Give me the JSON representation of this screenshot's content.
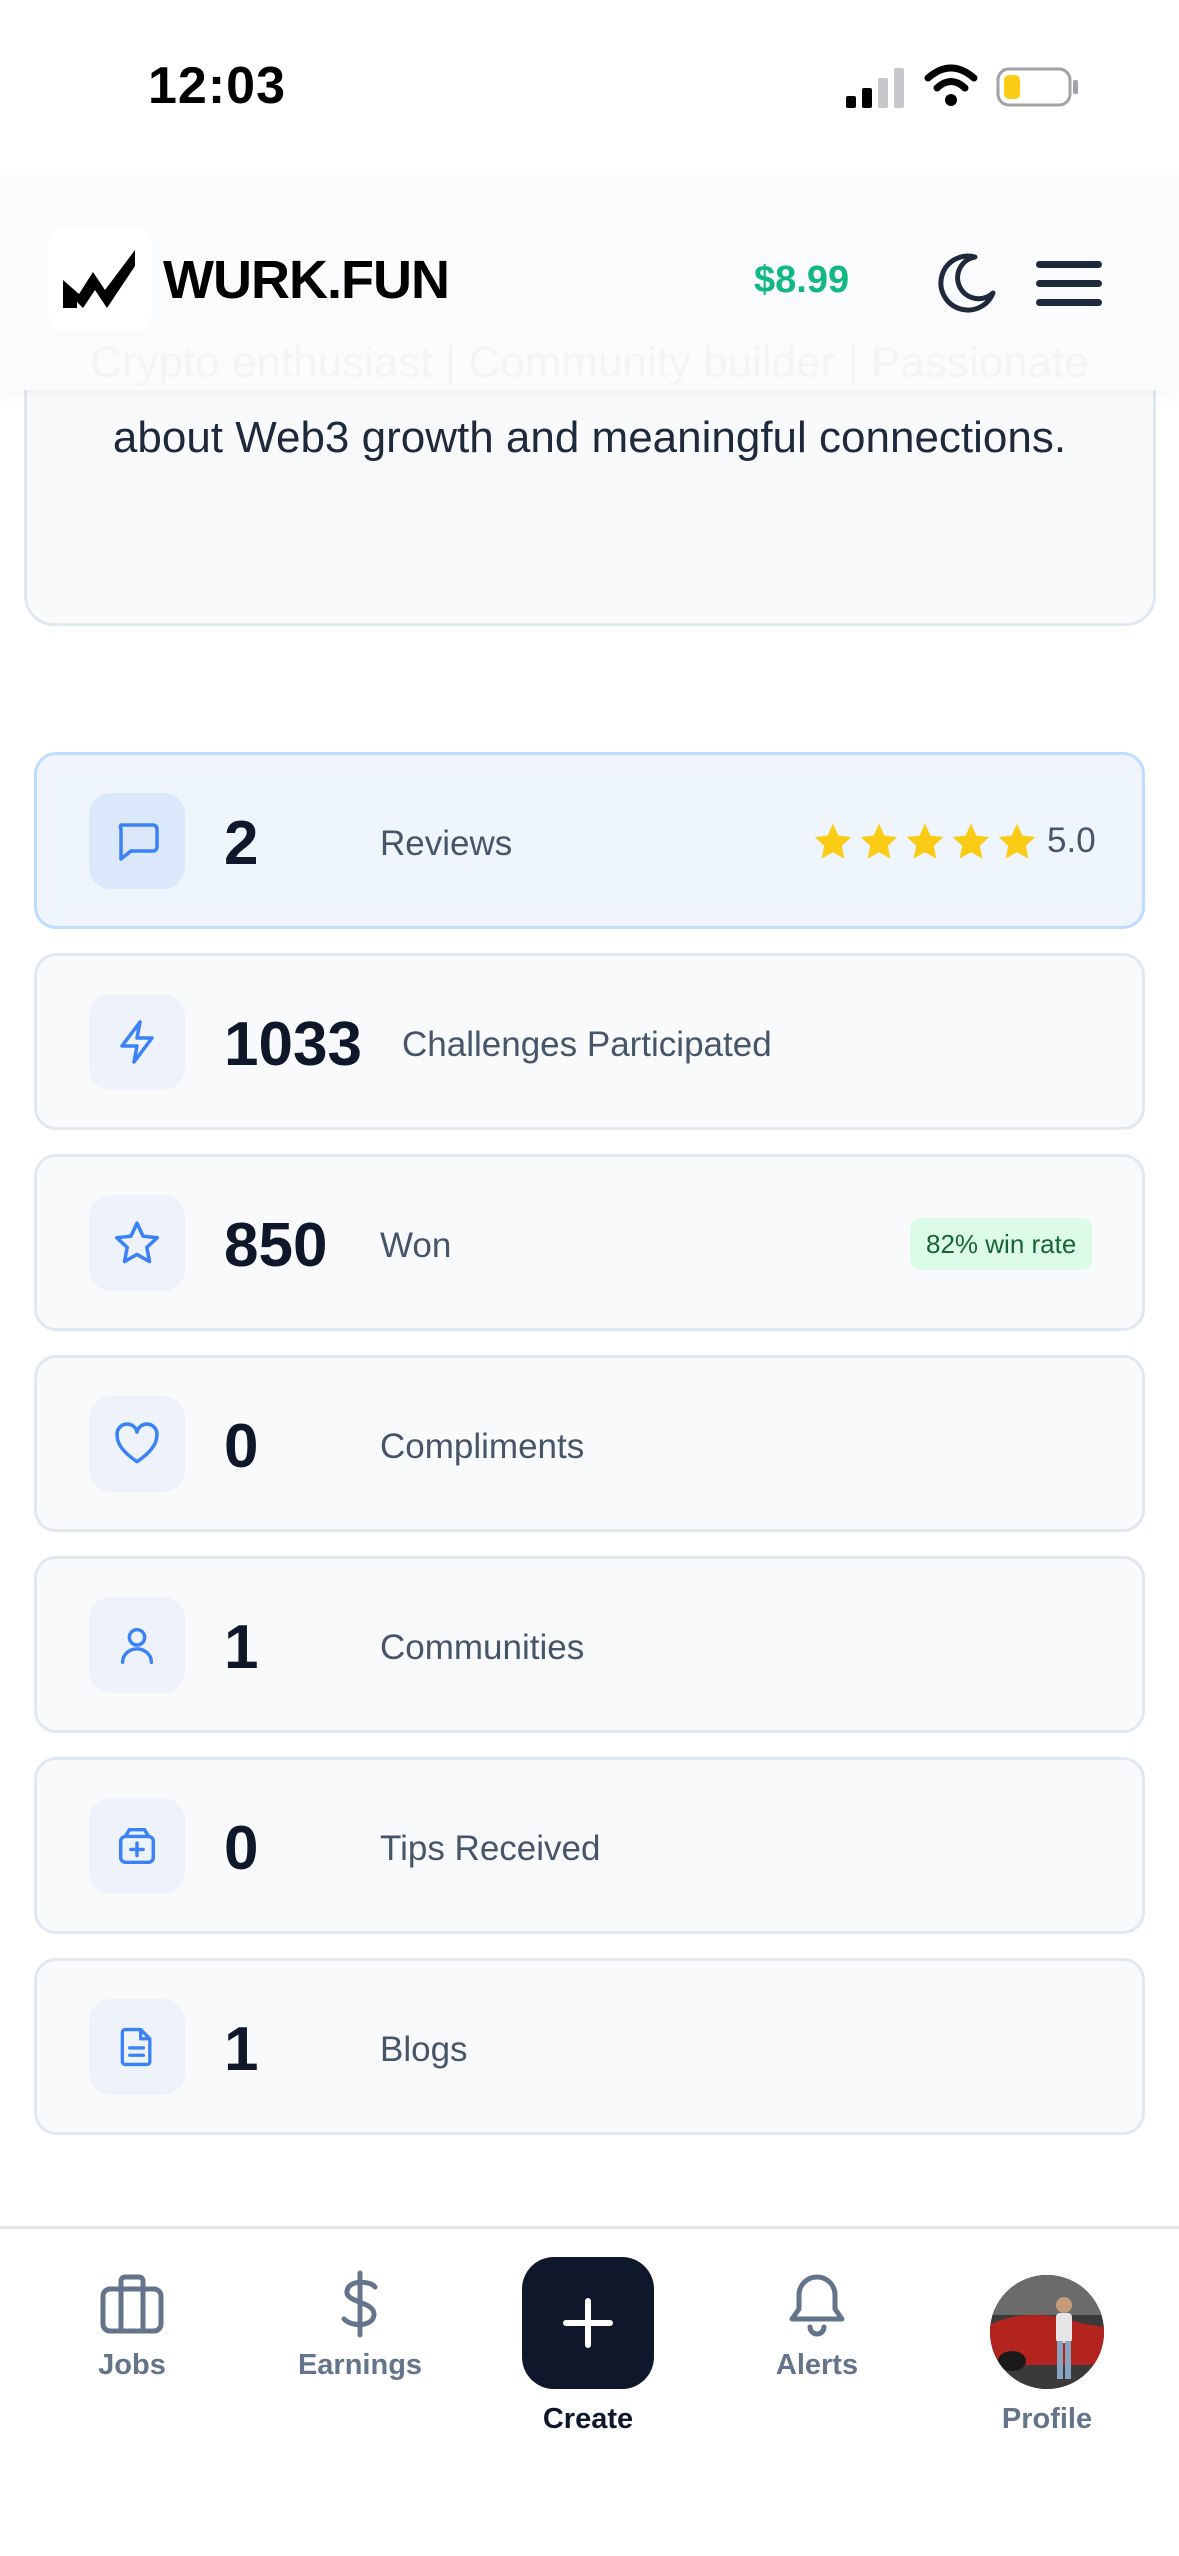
{
  "status_bar": {
    "time": "12:03"
  },
  "header": {
    "logo_text": "WURK.FUN",
    "balance": "$8.99"
  },
  "bio": {
    "text": "Crypto enthusiast | Community builder | Passionate about Web3 growth and meaningful connections."
  },
  "stats": [
    {
      "value": "2",
      "label": "Reviews",
      "icon": "chat-bubble-icon",
      "rating": "5.0",
      "stars": 5
    },
    {
      "value": "1033",
      "label": "Challenges Participated",
      "icon": "lightning-icon"
    },
    {
      "value": "850",
      "label": "Won",
      "icon": "star-icon",
      "badge": "82% win rate"
    },
    {
      "value": "0",
      "label": "Compliments",
      "icon": "heart-icon"
    },
    {
      "value": "1",
      "label": "Communities",
      "icon": "user-icon"
    },
    {
      "value": "0",
      "label": "Tips Received",
      "icon": "gift-box-icon"
    },
    {
      "value": "1",
      "label": "Blogs",
      "icon": "document-icon"
    }
  ],
  "nav": {
    "jobs": "Jobs",
    "earnings": "Earnings",
    "create": "Create",
    "alerts": "Alerts",
    "profile": "Profile"
  },
  "colors": {
    "accent_blue": "#3b82f6",
    "balance_green": "#10b981",
    "star_yellow": "#facc15",
    "dark": "#0f172a"
  }
}
